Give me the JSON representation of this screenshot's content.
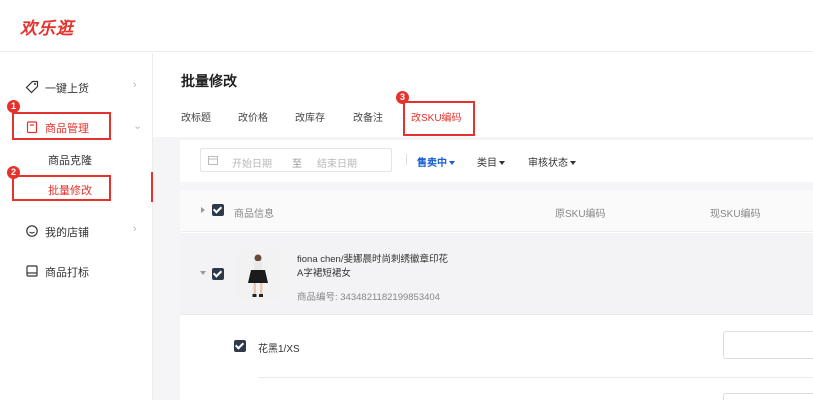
{
  "app": {
    "logo": "欢乐逛"
  },
  "sidebar": {
    "items": [
      {
        "label": "一键上货",
        "icon": "tag-icon"
      },
      {
        "label": "商品管理",
        "icon": "shopping-bag-icon"
      },
      {
        "label": "我的店铺",
        "icon": "store-icon"
      },
      {
        "label": "商品打标",
        "icon": "label-icon"
      }
    ],
    "subitems": [
      {
        "label": "商品克隆"
      },
      {
        "label": "批量修改"
      }
    ]
  },
  "annotations": {
    "badge1": "1",
    "badge2": "2",
    "badge3": "3",
    "color": "#e5322d"
  },
  "page": {
    "title": "批量修改",
    "tabs": [
      {
        "label": "改标题"
      },
      {
        "label": "改价格"
      },
      {
        "label": "改库存"
      },
      {
        "label": "改备注"
      },
      {
        "label": "改SKU编码"
      }
    ]
  },
  "filters": {
    "start_date_placeholder": "开始日期",
    "to": "至",
    "end_date_placeholder": "结束日期",
    "status": "售卖中",
    "category": "类目",
    "review": "审核状态"
  },
  "table": {
    "headers": [
      "商品信息",
      "原SKU编码",
      "现SKU编码"
    ],
    "product": {
      "name_line1": "fiona chen/斐娜晨时尚刺绣徽章印花",
      "name_line2": "A字裙短裙女",
      "code": "商品编号: 3434821182199853404"
    },
    "skus": [
      {
        "label": "花黑1/XS"
      }
    ]
  }
}
